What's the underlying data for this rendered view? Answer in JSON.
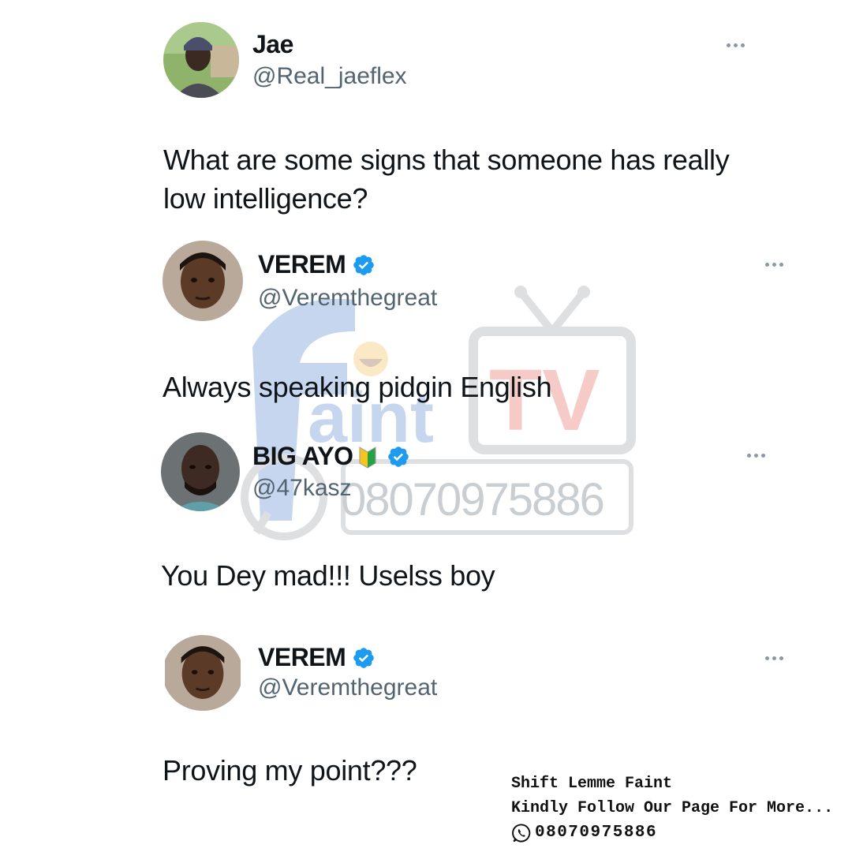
{
  "tweets": [
    {
      "name": "Jae",
      "handle": "@Real_jaeflex",
      "text_lines": [
        "What are some signs that someone has really",
        "low intelligence?"
      ],
      "verified": false
    },
    {
      "name": "VEREM",
      "handle": "@Veremthegreat",
      "text_lines": [
        "Always speaking pidgin English"
      ],
      "verified": true
    },
    {
      "name": "BIG AYO",
      "handle": "@47kasz",
      "text_lines": [
        "You Dey mad!!! Uselss boy"
      ],
      "verified": true,
      "badge_icon": "beginner-badge-icon"
    },
    {
      "name": "VEREM",
      "handle": "@Veremthegreat",
      "text_lines": [
        "Proving my point???"
      ],
      "verified": true
    }
  ],
  "watermark": {
    "brand": "FaintTV",
    "brand_part1": "Faint",
    "brand_part2": "TV",
    "phone": "08070975886"
  },
  "footer": {
    "line1": "Shift Lemme Faint",
    "line2": "Kindly Follow Our Page For More...",
    "phone": "08070975886",
    "icon": "whatsapp-icon"
  },
  "colors": {
    "verified_blue": "#1d9bf0",
    "text": "#0f1419",
    "handle_gray": "#536471",
    "watermark_blue": "#3b6fc7",
    "watermark_red": "#e0453a"
  }
}
